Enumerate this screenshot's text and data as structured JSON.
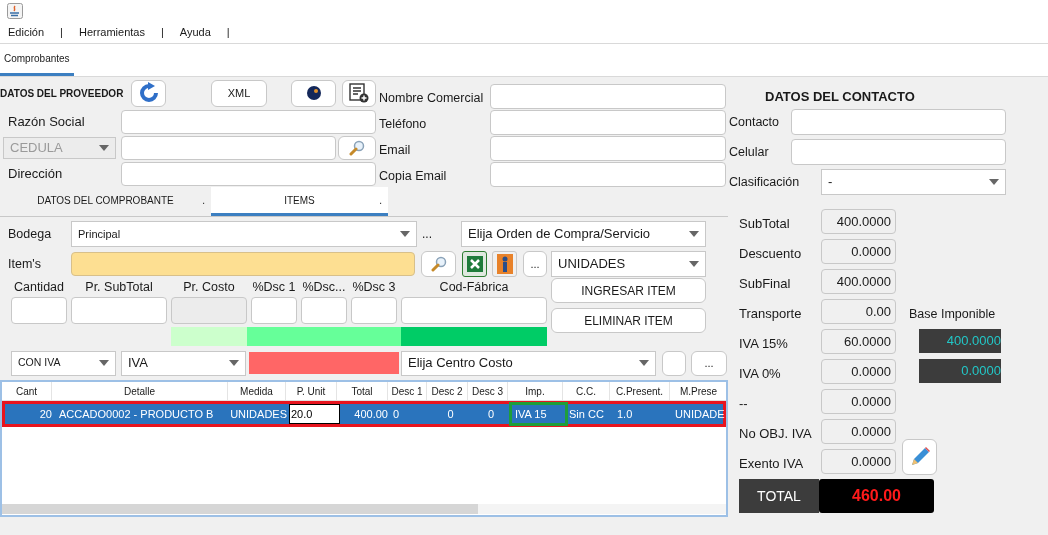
{
  "menu": [
    {
      "label": "Edición",
      "separator": "|"
    },
    {
      "label": "Herramientas",
      "separator": "|"
    },
    {
      "label": "Ayuda",
      "separator": "|"
    }
  ],
  "tabs": [
    {
      "label": "Comprobantes",
      "selected": true
    }
  ],
  "provider": {
    "title": "DATOS DEL PROVEEDOR",
    "xml_button": "XML",
    "fields": [
      {
        "kind": "text",
        "label": "Razón Social"
      },
      {
        "kind": "id",
        "select": "CEDULA",
        "disabled": true
      },
      {
        "kind": "text",
        "label": "Dirección"
      }
    ]
  },
  "commercial": {
    "fields": [
      "Nombre Comercial",
      "Teléfono",
      "Email",
      "Copia Email"
    ]
  },
  "contact": {
    "title": "DATOS DEL CONTACTO",
    "fields": [
      {
        "kind": "text",
        "label": "Contacto"
      },
      {
        "kind": "text",
        "label": "Celular"
      },
      {
        "kind": "select",
        "label": "Clasificación",
        "value": "-"
      }
    ]
  },
  "subtabs": [
    {
      "label": "DATOS DEL COMPROBANTE",
      "mark": ".",
      "selected": false
    },
    {
      "label": "ITEMS",
      "mark": ".",
      "selected": true
    }
  ],
  "items_form": {
    "bodega_label": "Bodega",
    "bodega": "Principal",
    "ellipsis": "...",
    "purchase_order": "Elija Orden de Compra/Servicio",
    "item_label": "Item's",
    "more_button": "...",
    "unit": "UNIDADES",
    "fields": [
      {
        "label": "Cantidad",
        "disabled": false
      },
      {
        "label": "Pr. SubTotal",
        "disabled": false
      },
      {
        "label": "Pr. Costo",
        "disabled": true
      },
      {
        "label": "%Dsc 1",
        "disabled": false
      },
      {
        "label": "%Dsc...",
        "disabled": false
      },
      {
        "label": "%Dsc 3",
        "disabled": false
      },
      {
        "label": "Cod-Fábrica",
        "disabled": false
      }
    ],
    "add_button": "INGRESAR ITEM",
    "remove_button": "ELIMINAR ITEM",
    "tax_mode": "CON IVA",
    "tax": "IVA",
    "cost_center": "Elija Centro Costo",
    "more_button_2": "..."
  },
  "table": {
    "columns": [
      "Cant",
      "Detalle",
      "Medida",
      "P. Unit",
      "Total",
      "Desc 1",
      "Desc 2",
      "Desc 3",
      "Imp.",
      "C.C.",
      "C.Present.",
      "M.Prese"
    ],
    "rows": [
      {
        "selected": true,
        "outlined": true,
        "cells": [
          {
            "text": "20",
            "editing": false,
            "highlighted": false
          },
          {
            "text": "ACCADO0002 - PRODUCTO B",
            "editing": false,
            "highlighted": false
          },
          {
            "text": "UNIDADES",
            "editing": false,
            "highlighted": false
          },
          {
            "text": "20.0",
            "editing": true,
            "highlighted": false
          },
          {
            "text": "400.00",
            "editing": false,
            "highlighted": false
          },
          {
            "text": "0",
            "editing": false,
            "highlighted": false
          },
          {
            "text": "0",
            "editing": false,
            "highlighted": false
          },
          {
            "text": "0",
            "editing": false,
            "highlighted": false
          },
          {
            "text": "IVA 15",
            "editing": false,
            "highlighted": true
          },
          {
            "text": "Sin CC",
            "editing": false,
            "highlighted": false
          },
          {
            "text": "1.0",
            "editing": false,
            "highlighted": false
          },
          {
            "text": "UNIDADE",
            "editing": false,
            "highlighted": false
          }
        ]
      }
    ]
  },
  "totals": {
    "rows": [
      {
        "label": "SubTotal",
        "value": "400.0000"
      },
      {
        "label": "Descuento",
        "value": "0.0000"
      },
      {
        "label": "SubFinal",
        "value": "400.0000"
      },
      {
        "label": "Transporte",
        "value": "0.00"
      },
      {
        "label": "IVA 15%",
        "value": "60.0000"
      },
      {
        "label": "IVA 0%",
        "value": "0.0000"
      },
      {
        "label": "--",
        "value": "0.0000"
      },
      {
        "label": "No OBJ. IVA",
        "value": "0.0000"
      },
      {
        "label": "Exento IVA",
        "value": "0.0000"
      }
    ],
    "base_imponible": {
      "label": "Base Imponible",
      "values": [
        "400.0000",
        "0.0000"
      ]
    },
    "total_label": "TOTAL",
    "total_value": "460.00"
  }
}
